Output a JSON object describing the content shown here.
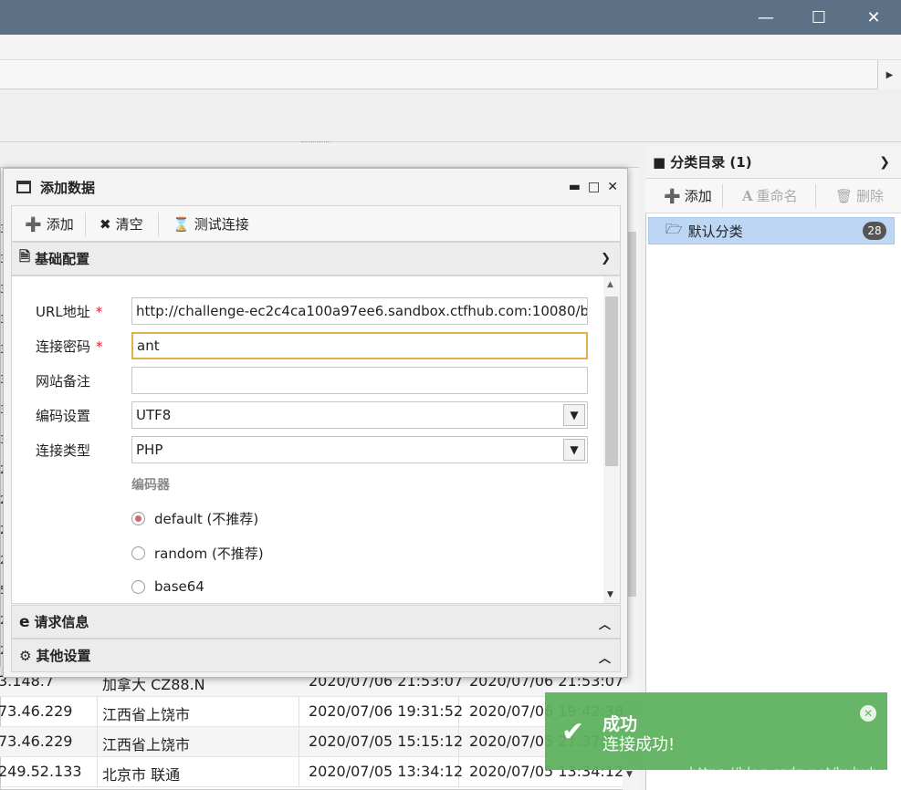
{
  "window": {
    "min": "—",
    "max": "☐",
    "close": "✕"
  },
  "list": {
    "left_numbers": [
      "3",
      "3",
      "3",
      "3",
      "3",
      "3",
      "3",
      "3",
      "2",
      "2",
      "2",
      "2",
      "5",
      "2",
      "2",
      "2"
    ],
    "rows": [
      {
        "ip": "3.148.7",
        "location": "加拿大 CZ88.N",
        "created": "2020/07/06 21:53:07",
        "updated": "2020/07/06 21:53:07"
      },
      {
        "ip": "73.46.229",
        "location": "江西省上饶市",
        "created": "2020/07/06 19:31:52",
        "updated": "2020/07/06 19:42:38"
      },
      {
        "ip": "73.46.229",
        "location": "江西省上饶市",
        "created": "2020/07/05 15:15:12",
        "updated": "2020/07/05 21:37:2"
      },
      {
        "ip": "249.52.133",
        "location": "北京市 联通",
        "created": "2020/07/05 13:34:12",
        "updated": "2020/07/05 13:34:12"
      }
    ]
  },
  "category": {
    "title": "分类目录 (1)",
    "add": "添加",
    "rename": "重命名",
    "delete": "删除",
    "items": [
      {
        "label": "默认分类",
        "count": "28"
      }
    ]
  },
  "dialog": {
    "title": "添加数据",
    "toolbar": {
      "add": "添加",
      "clear": "清空",
      "test": "测试连接"
    },
    "section_basic": "基础配置",
    "section_request": "请求信息",
    "section_other": "其他设置",
    "fields": {
      "url_label": "URL地址",
      "url_value": "http://challenge-ec2c4ca100a97ee6.sandbox.ctfhub.com:10080/backdoor/",
      "pwd_label": "连接密码",
      "pwd_value": "ant",
      "note_label": "网站备注",
      "note_value": "",
      "encoding_label": "编码设置",
      "encoding_value": "UTF8",
      "type_label": "连接类型",
      "type_value": "PHP",
      "required_mark": "*"
    },
    "encoder_label": "编码器",
    "encoders": [
      {
        "label": "default (不推荐)",
        "selected": true
      },
      {
        "label": "random (不推荐)",
        "selected": false
      },
      {
        "label": "base64",
        "selected": false
      }
    ]
  },
  "toast": {
    "title": "成功",
    "message": "连接成功!",
    "color": "#5fb25f"
  },
  "watermark": "https://blog.csdn.net/hxhxhxhxx"
}
